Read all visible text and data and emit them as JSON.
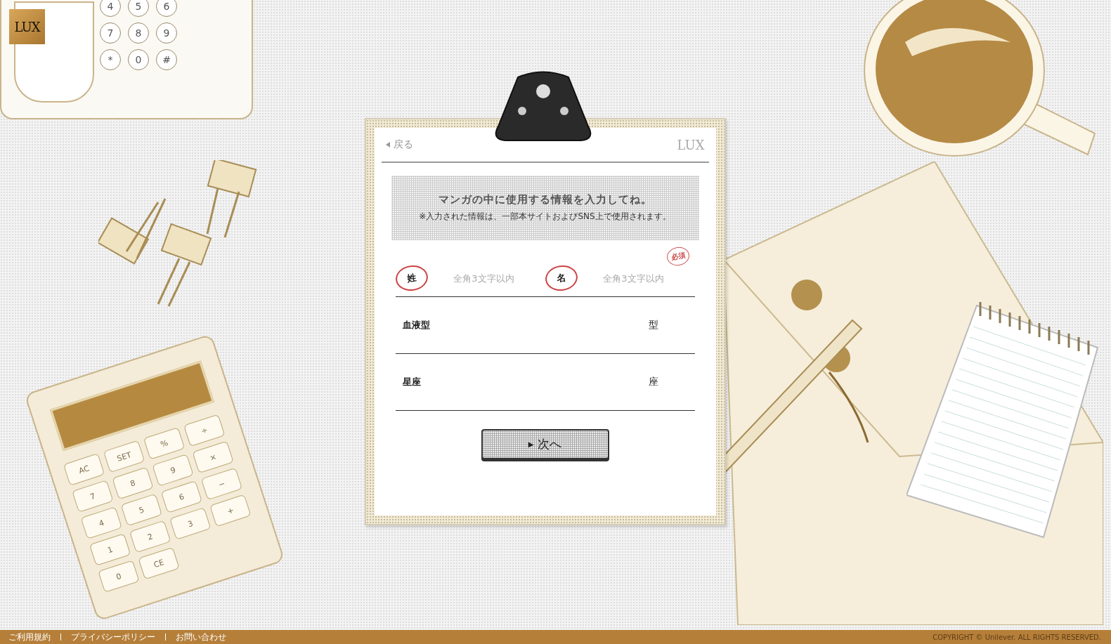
{
  "logo": {
    "text": "LUX"
  },
  "phone_keys": [
    "4",
    "5",
    "6",
    "7",
    "8",
    "9",
    "*",
    "0",
    "#"
  ],
  "calculator_keys": [
    "AC",
    "SET",
    "%",
    "÷",
    "7",
    "8",
    "9",
    "×",
    "4",
    "5",
    "6",
    "−",
    "1",
    "2",
    "3",
    "+",
    "0",
    "CE"
  ],
  "clipboard": {
    "back_link": "戻る",
    "brand": "LUX"
  },
  "intro": {
    "title": "マンガの中に使用する情報を入力してね。",
    "note": "※入力された情報は、一部本サイトおよびSNS上で使用されます。"
  },
  "required_badge": "必須",
  "name_fields": [
    {
      "label": "姓",
      "placeholder": "全角3文字以内"
    },
    {
      "label": "名",
      "placeholder": "全角3文字以内"
    }
  ],
  "select_fields": [
    {
      "label": "血液型",
      "suffix": "型"
    },
    {
      "label": "星座",
      "suffix": "座"
    }
  ],
  "next_button": {
    "icon": "▶",
    "label": "次へ"
  },
  "footer": {
    "links": [
      "ご利用規約",
      "プライバシーポリシー",
      "お問い合わせ"
    ],
    "copyright": "COPYRIGHT © Unilever. ALL RIGHTS RESERVED."
  }
}
